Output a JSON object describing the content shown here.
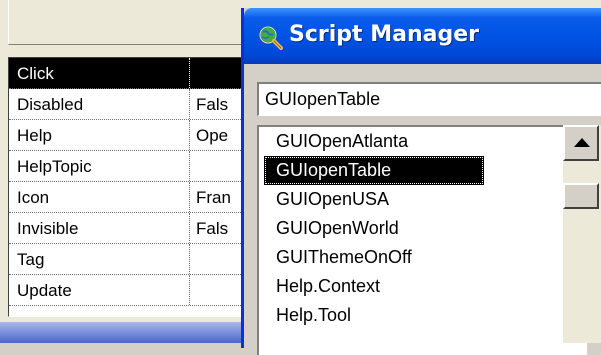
{
  "properties": {
    "rows": [
      {
        "name": "Click",
        "value": ""
      },
      {
        "name": "Disabled",
        "value": "Fals"
      },
      {
        "name": "Help",
        "value": "Ope"
      },
      {
        "name": "HelpTopic",
        "value": ""
      },
      {
        "name": "Icon",
        "value": "Fran"
      },
      {
        "name": "Invisible",
        "value": "Fals"
      },
      {
        "name": "Tag",
        "value": ""
      },
      {
        "name": "Update",
        "value": ""
      }
    ],
    "selected_index": 0
  },
  "script_manager": {
    "title": "Script Manager",
    "icon": "magnifier-globe-icon",
    "input_value": "GUIopenTable",
    "items": [
      "GUIOpenAtlanta",
      "GUIopenTable",
      "GUIOpenUSA",
      "GUIOpenWorld",
      "GUIThemeOnOff",
      "Help.Context",
      "Help.Tool"
    ],
    "selected_index": 1
  },
  "colors": {
    "titlebar": "#0054e3",
    "selection": "#000000",
    "window_bg": "#d4d0c8"
  }
}
